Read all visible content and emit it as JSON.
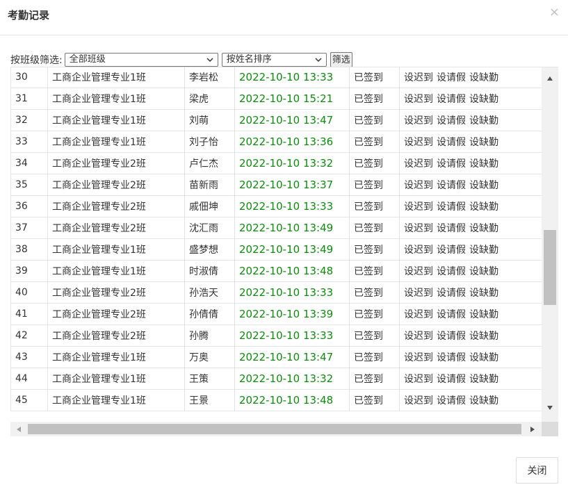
{
  "dialog": {
    "title": "考勤记录",
    "close_glyph": "×",
    "close_button_label": "关闭"
  },
  "filter": {
    "label": "按班级筛选:",
    "class_select_value": "全部班级",
    "sort_select_value": "按姓名排序",
    "submit_label": "筛选"
  },
  "rows": [
    {
      "no": "30",
      "class": "工商企业管理专业1班",
      "name": "李岩松",
      "time": "2022-10-10 13:33",
      "status": "已签到"
    },
    {
      "no": "31",
      "class": "工商企业管理专业1班",
      "name": "梁虎",
      "time": "2022-10-10 15:21",
      "status": "已签到"
    },
    {
      "no": "32",
      "class": "工商企业管理专业1班",
      "name": "刘萌",
      "time": "2022-10-10 13:47",
      "status": "已签到"
    },
    {
      "no": "33",
      "class": "工商企业管理专业1班",
      "name": "刘子怡",
      "time": "2022-10-10 13:36",
      "status": "已签到"
    },
    {
      "no": "34",
      "class": "工商企业管理专业2班",
      "name": "卢仁杰",
      "time": "2022-10-10 13:32",
      "status": "已签到"
    },
    {
      "no": "35",
      "class": "工商企业管理专业2班",
      "name": "苗新雨",
      "time": "2022-10-10 13:37",
      "status": "已签到"
    },
    {
      "no": "36",
      "class": "工商企业管理专业2班",
      "name": "戚佃坤",
      "time": "2022-10-10 13:33",
      "status": "已签到"
    },
    {
      "no": "37",
      "class": "工商企业管理专业2班",
      "name": "沈汇雨",
      "time": "2022-10-10 13:49",
      "status": "已签到"
    },
    {
      "no": "38",
      "class": "工商企业管理专业1班",
      "name": "盛梦想",
      "time": "2022-10-10 13:49",
      "status": "已签到"
    },
    {
      "no": "39",
      "class": "工商企业管理专业1班",
      "name": "时淑倩",
      "time": "2022-10-10 13:48",
      "status": "已签到"
    },
    {
      "no": "40",
      "class": "工商企业管理专业2班",
      "name": "孙浩天",
      "time": "2022-10-10 13:33",
      "status": "已签到"
    },
    {
      "no": "41",
      "class": "工商企业管理专业2班",
      "name": "孙倩倩",
      "time": "2022-10-10 13:39",
      "status": "已签到"
    },
    {
      "no": "42",
      "class": "工商企业管理专业2班",
      "name": "孙腾",
      "time": "2022-10-10 13:33",
      "status": "已签到"
    },
    {
      "no": "43",
      "class": "工商企业管理专业1班",
      "name": "万奥",
      "time": "2022-10-10 13:47",
      "status": "已签到"
    },
    {
      "no": "44",
      "class": "工商企业管理专业1班",
      "name": "王策",
      "time": "2022-10-10 13:32",
      "status": "已签到"
    },
    {
      "no": "45",
      "class": "工商企业管理专业1班",
      "name": "王景",
      "time": "2022-10-10 13:48",
      "status": "已签到"
    }
  ],
  "actions": {
    "late": "设迟到",
    "leave": "设请假",
    "absent": "设缺勤"
  },
  "colors": {
    "time_text": "#0f8a0f",
    "border": "#e5e5e5",
    "scrollbar_thumb": "#c1c1c1"
  }
}
